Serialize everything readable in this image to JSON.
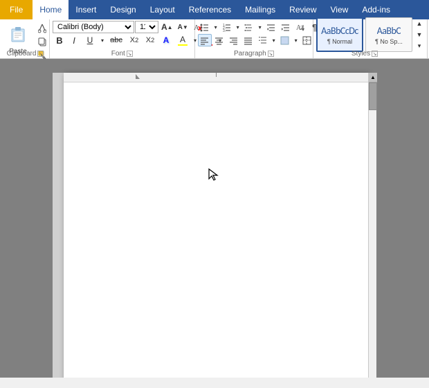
{
  "menu": {
    "items": [
      {
        "label": "File",
        "id": "file",
        "active": false
      },
      {
        "label": "Home",
        "id": "home",
        "active": true
      },
      {
        "label": "Insert",
        "id": "insert",
        "active": false
      },
      {
        "label": "Design",
        "id": "design",
        "active": false
      },
      {
        "label": "Layout",
        "id": "layout",
        "active": false
      },
      {
        "label": "References",
        "id": "references",
        "active": false
      },
      {
        "label": "Mailings",
        "id": "mailings",
        "active": false
      },
      {
        "label": "Review",
        "id": "review",
        "active": false
      },
      {
        "label": "View",
        "id": "view",
        "active": false
      },
      {
        "label": "Add-ins",
        "id": "addins",
        "active": false
      }
    ]
  },
  "ribbon": {
    "clipboard": {
      "paste_label": "Paste",
      "cut_label": "Cut",
      "copy_label": "Copy",
      "format_painter_label": "Format Painter",
      "section_label": "Clipboard"
    },
    "font": {
      "font_name": "Calibri (Body)",
      "font_size": "11",
      "grow_label": "A",
      "shrink_label": "A",
      "clear_label": "A",
      "bold_label": "B",
      "italic_label": "I",
      "underline_label": "U",
      "strikethrough_label": "abc",
      "subscript_label": "X₂",
      "superscript_label": "X²",
      "text_effects_label": "A",
      "highlight_label": "A",
      "font_color_label": "A",
      "section_label": "Font"
    },
    "paragraph": {
      "section_label": "Paragraph"
    },
    "styles": {
      "style1_name": "AaBbCcDc",
      "style1_label": "¶ Normal",
      "style2_name": "AaBbC",
      "style2_label": "¶ No Sp...",
      "section_label": "Styles"
    }
  },
  "doc": {
    "background_color": "#808080"
  },
  "colors": {
    "accent": "#2b579a",
    "tab_active_bg": "white",
    "tab_file_bg": "#e8a800",
    "underline_u": "#0070c0",
    "underline_a_font": "#ff0000",
    "underline_a_highlight": "#ffff00"
  }
}
